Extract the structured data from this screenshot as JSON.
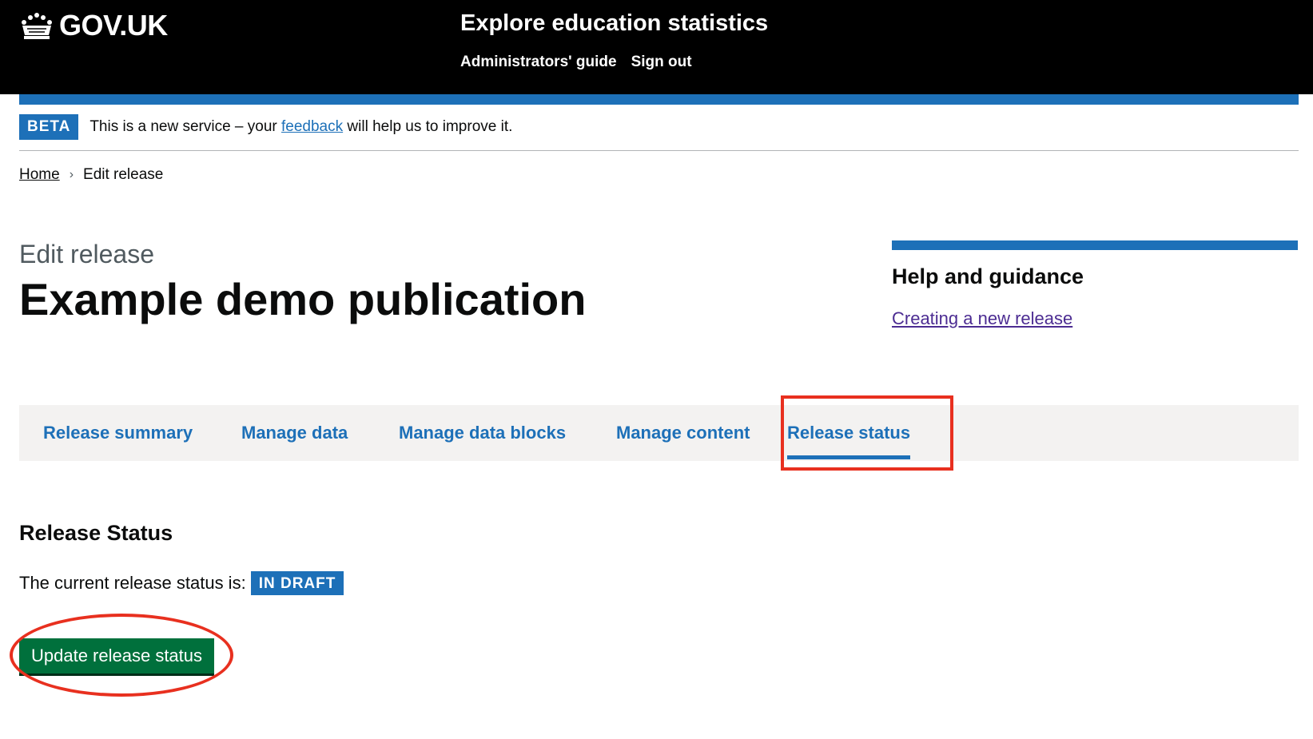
{
  "header": {
    "logo_text": "GOV.UK",
    "service_name": "Explore education statistics",
    "nav": [
      {
        "label": "Administrators' guide"
      },
      {
        "label": "Sign out"
      }
    ]
  },
  "beta_banner": {
    "tag": "BETA",
    "text_before": "This is a new service – your ",
    "link_text": "feedback",
    "text_after": " will help us to improve it."
  },
  "breadcrumb": {
    "home": "Home",
    "current": "Edit release"
  },
  "page": {
    "caption": "Edit release",
    "title": "Example demo publication"
  },
  "help": {
    "heading": "Help and guidance",
    "link": "Creating a new release"
  },
  "tabs": [
    {
      "label": "Release summary",
      "active": false
    },
    {
      "label": "Manage data",
      "active": false
    },
    {
      "label": "Manage data blocks",
      "active": false
    },
    {
      "label": "Manage content",
      "active": false
    },
    {
      "label": "Release status",
      "active": true
    }
  ],
  "release_status": {
    "heading": "Release Status",
    "current_label": "The current release status is:",
    "status_tag": "IN DRAFT",
    "update_button": "Update release status"
  },
  "colors": {
    "header_bg": "#000000",
    "brand_blue": "#1d70b8",
    "button_green": "#00703c",
    "annotation_red": "#e8301f",
    "visited_link": "#4c2c92"
  }
}
